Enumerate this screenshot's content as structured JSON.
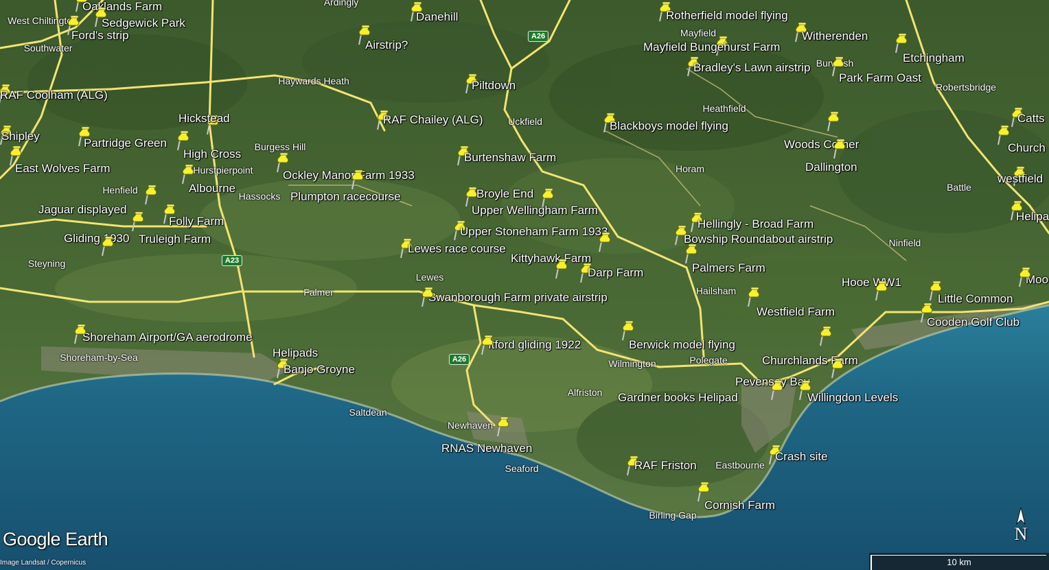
{
  "app": {
    "brand": "Google Earth",
    "imagery_credit": "Image Landsat / Copernicus",
    "north_label": "N",
    "scale_label": "10 km"
  },
  "roads": [
    {
      "label": "A26"
    },
    {
      "label": "A23"
    },
    {
      "label": "A26"
    }
  ],
  "placemarks": [
    {
      "label": "Oaklands Farm"
    },
    {
      "label": "Sedgewick Park"
    },
    {
      "label": "Ford's strip"
    },
    {
      "label": "Danehill"
    },
    {
      "label": "Airstrip?"
    },
    {
      "label": "Rotherfield model flying"
    },
    {
      "label": "Witherenden"
    },
    {
      "label": "Mayfield Bungehurst Farm"
    },
    {
      "label": "Etchingham"
    },
    {
      "label": "Bradley's Lawn airstrip"
    },
    {
      "label": "Park Farm Oast"
    },
    {
      "label": "RAF Coolham (ALG)"
    },
    {
      "label": "Piltdown"
    },
    {
      "label": "Hickstead"
    },
    {
      "label": "RAF Chailey (ALG)"
    },
    {
      "label": "Blackboys model flying"
    },
    {
      "label": "Catts"
    },
    {
      "label": "Shipley"
    },
    {
      "label": "Partridge Green"
    },
    {
      "label": "High Cross"
    },
    {
      "label": "Woods Corner"
    },
    {
      "label": "Church"
    },
    {
      "label": "Burtenshaw Farm"
    },
    {
      "label": "East Wolves Farm"
    },
    {
      "label": "Ockley Manor Farm 1933"
    },
    {
      "label": "Dallington"
    },
    {
      "label": "Albourne"
    },
    {
      "label": "westfield"
    },
    {
      "label": "Plumpton racecourse"
    },
    {
      "label": "Broyle End"
    },
    {
      "label": "Jaguar displayed"
    },
    {
      "label": "Upper Wellingham Farm"
    },
    {
      "label": "Folly Farm"
    },
    {
      "label": "Helipa"
    },
    {
      "label": "Hellingly - Broad Farm"
    },
    {
      "label": "Upper Stoneham Farm 1933"
    },
    {
      "label": "Gliding 1930"
    },
    {
      "label": "Truleigh Farm"
    },
    {
      "label": "Bowship Roundabout airstrip"
    },
    {
      "label": "Lewes race course"
    },
    {
      "label": "Kittyhawk Farm"
    },
    {
      "label": "Palmers Farm"
    },
    {
      "label": "Darp Farm"
    },
    {
      "label": "Hooe WW1"
    },
    {
      "label": "Moo"
    },
    {
      "label": "Swanborough Farm private airstrip"
    },
    {
      "label": "Little Common"
    },
    {
      "label": "Westfield Farm"
    },
    {
      "label": "Cooden Golf Club"
    },
    {
      "label": "Shoreham Airport/GA aerodrome"
    },
    {
      "label": "Berwick model flying"
    },
    {
      "label": "Itford gliding 1922"
    },
    {
      "label": "Helipads"
    },
    {
      "label": "Churchlands Farm"
    },
    {
      "label": "Banjo Groyne"
    },
    {
      "label": "Pevensey Bay"
    },
    {
      "label": "Gardner books Helipad"
    },
    {
      "label": "Willingdon Levels"
    },
    {
      "label": "RNAS Newhaven"
    },
    {
      "label": "Crash site"
    },
    {
      "label": "RAF Friston"
    },
    {
      "label": "Cornish Farm"
    }
  ],
  "places": [
    {
      "label": "West Chiltington"
    },
    {
      "label": "Ardingly"
    },
    {
      "label": "Southwater"
    },
    {
      "label": "Mayfield"
    },
    {
      "label": "Burwash"
    },
    {
      "label": "Haywards Heath"
    },
    {
      "label": "Robertsbridge"
    },
    {
      "label": "Heathfield"
    },
    {
      "label": "Uckfield"
    },
    {
      "label": "Burgess Hill"
    },
    {
      "label": "Horam"
    },
    {
      "label": "Hurstpierpoint"
    },
    {
      "label": "Henfield"
    },
    {
      "label": "Battle"
    },
    {
      "label": "Hassocks"
    },
    {
      "label": "Ninfield"
    },
    {
      "label": "Steyning"
    },
    {
      "label": "Lewes"
    },
    {
      "label": "Falmer"
    },
    {
      "label": "Hailsham"
    },
    {
      "label": "Shoreham-by-Sea"
    },
    {
      "label": "Wilmington"
    },
    {
      "label": "Polegate"
    },
    {
      "label": "Alfriston"
    },
    {
      "label": "Saltdean"
    },
    {
      "label": "Newhaven"
    },
    {
      "label": "Seaford"
    },
    {
      "label": "Eastbourne"
    },
    {
      "label": "Birling Gap"
    }
  ]
}
